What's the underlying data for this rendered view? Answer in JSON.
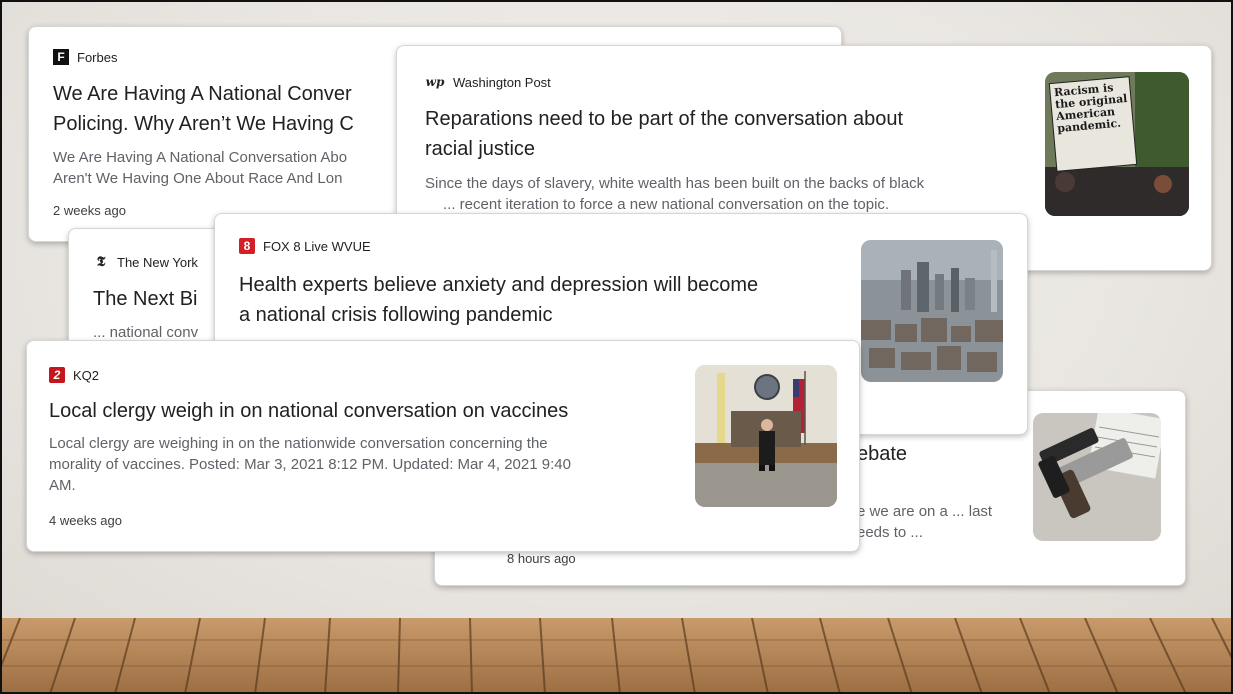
{
  "cards": {
    "forbes": {
      "source": "Forbes",
      "title_line1": "We Are Having A National Conver",
      "title_line2": "Policing. Why Aren’t We Having C",
      "snippet_line1": "We Are Having A National Conversation Abo",
      "snippet_line2": "Aren't We Having One About Race And Lon",
      "time": "2 weeks ago"
    },
    "wapo": {
      "source": "Washington Post",
      "title_line1": "Reparations need to be part of the conversation about",
      "title_line2": "racial justice",
      "snippet_line1": "Since the days of slavery, white wealth has been built on the backs of black",
      "snippet_line2": "... recent iteration to force a new national conversation on the topic.",
      "thumb_sign": "Racism is the original American pandemic."
    },
    "nyt": {
      "source": "The New York",
      "title": "The Next Bi",
      "snippet": "... national conv"
    },
    "fox8": {
      "source": "FOX 8 Live WVUE",
      "title_line1": "Health experts believe anxiety and depression will become",
      "title_line2": "a national crisis following pandemic"
    },
    "debate": {
      "title_fragment": "ebate",
      "snippet_line1": "e we are on a ... last",
      "snippet_line2": "eeds to ...",
      "time": "8 hours ago"
    },
    "kq2": {
      "source": "KQ2",
      "title": "Local clergy weigh in on national conversation on vaccines",
      "snippet_line1": "Local clergy are weighing in on the nationwide conversation concerning the",
      "snippet_line2": "morality of vaccines. Posted: Mar 3, 2021 8:12 PM. Updated: Mar 4, 2021 9:40",
      "snippet_line3": "AM.",
      "time": "4 weeks ago"
    }
  },
  "logos": {
    "forbes": "F",
    "wapo": "wp",
    "nyt": "𝕿",
    "fox8": "8",
    "kq2": "2"
  },
  "colors": {
    "fox_red": "#d32027",
    "kq2_red": "#c4161c",
    "title": "#202124",
    "snippet": "#5f6368"
  }
}
